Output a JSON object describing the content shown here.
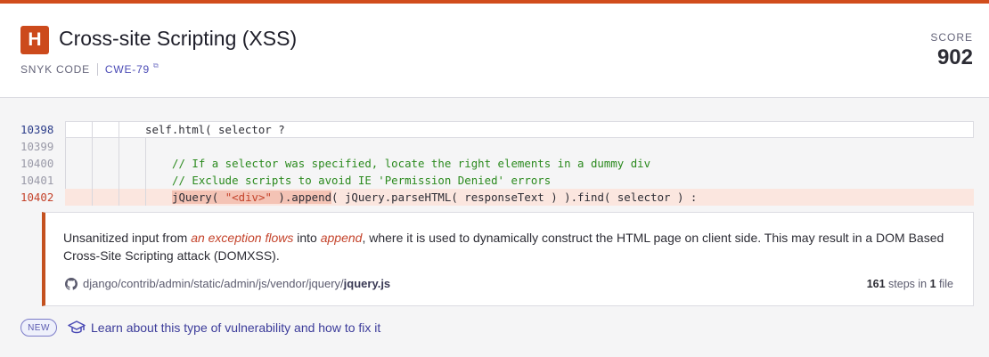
{
  "issue": {
    "severity_letter": "H",
    "title": "Cross-site Scripting (XSS)",
    "source": "SNYK CODE",
    "cwe": "CWE-79",
    "score_label": "SCORE",
    "score_value": "902",
    "severity_color": "#cc4a1c"
  },
  "code": {
    "lines": [
      {
        "number": "10398",
        "text": "self.html( selector ?"
      },
      {
        "number": "10399",
        "text": ""
      },
      {
        "number": "10400",
        "text": "// If a selector was specified, locate the right elements in a dummy div"
      },
      {
        "number": "10401",
        "text": "// Exclude scripts to avoid IE 'Permission Denied' errors"
      },
      {
        "number": "10402",
        "text_prefix": "jQuery( ",
        "text_string": "\"<div>\"",
        "text_mid": " ).append",
        "text_suffix": "( jQuery.parseHTML( responseText ) ).find( selector ) :"
      }
    ]
  },
  "panel": {
    "msg_1": "Unsanitized input from ",
    "msg_source": "an exception flows",
    "msg_2": " into ",
    "msg_sink": "append",
    "msg_3": ", where it is used to dynamically construct the HTML page on client side. This may result in a DOM Based Cross-Site Scripting attack (DOMXSS).",
    "file_path": "django/contrib/admin/static/admin/js/vendor/jquery/",
    "file_name": "jquery.js",
    "steps_count": "161",
    "steps_text_1": " steps in ",
    "files_count": "1",
    "steps_text_2": " file"
  },
  "learn": {
    "badge": "NEW",
    "text": "Learn about this type of vulnerability and how to fix it",
    "icon": "graduation-cap-icon"
  }
}
